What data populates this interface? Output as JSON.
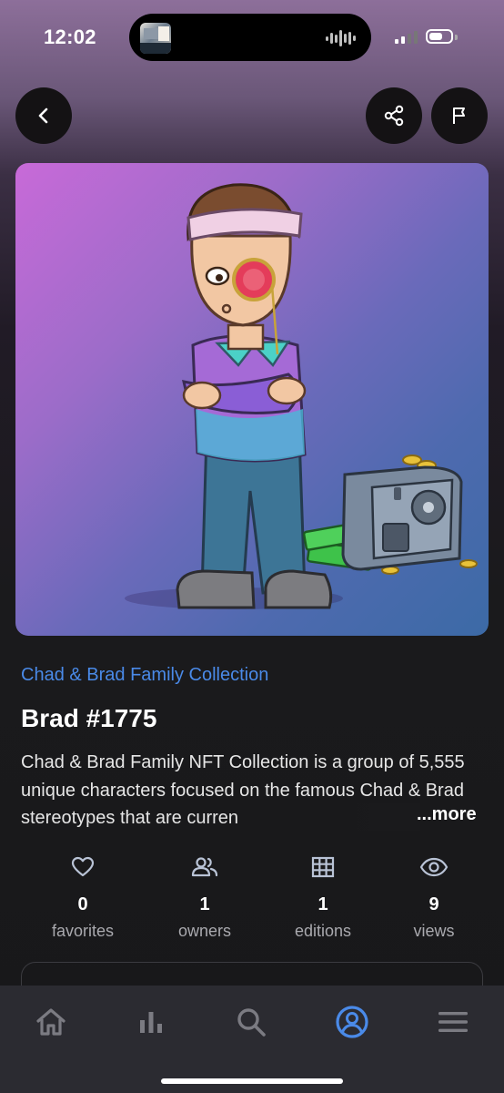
{
  "status_bar": {
    "time": "12:02"
  },
  "collection_name": "Chad & Brad Family Collection",
  "nft_title": "Brad #1775",
  "description": "Chad & Brad Family NFT Collection is a group of 5,555 unique characters focused on the famous Chad & Brad stereotypes that are curren",
  "more_label": "...more",
  "stats": [
    {
      "icon": "heart-icon",
      "value": "0",
      "label": "favorites"
    },
    {
      "icon": "people-icon",
      "value": "1",
      "label": "owners"
    },
    {
      "icon": "grid-icon",
      "value": "1",
      "label": "editions"
    },
    {
      "icon": "eye-icon",
      "value": "9",
      "label": "views"
    }
  ],
  "tab_bar": {
    "items": [
      "home-icon",
      "stats-icon",
      "search-icon",
      "profile-icon",
      "menu-icon"
    ],
    "active": "profile-icon"
  },
  "colors": {
    "accent": "#4a8ae8",
    "tab_inactive": "#7b7b82",
    "tab_bar_bg": "#2b2b31"
  }
}
